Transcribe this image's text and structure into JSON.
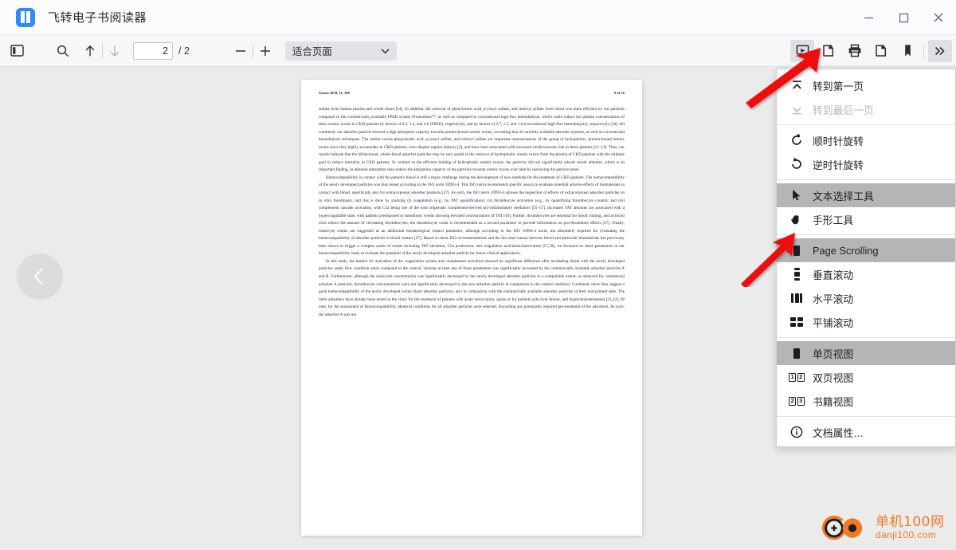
{
  "window": {
    "title": "飞转电子书阅读器",
    "app_icon": "book-icon",
    "minimize_label": "−",
    "maximize_label": "□",
    "close_label": "×"
  },
  "toolbar": {
    "sidebar_toggle": "sidebar-toggle-icon",
    "search": "search-icon",
    "prev_match": "arrow-up-icon",
    "next_match": "arrow-down-icon",
    "page_value": "2",
    "page_total": "/ 2",
    "page_placeholder": "",
    "zoom_out_label": "−",
    "zoom_in_label": "+",
    "zoom_select_value": "适合页面",
    "zoom_chevron": "chevron-down-icon",
    "presentation": "presentation-icon",
    "open_file": "open-file-icon",
    "print": "print-icon",
    "save_file": "save-file-icon",
    "bookmark": "bookmark-icon",
    "more_label": "»"
  },
  "menu": {
    "groups": [
      {
        "items": [
          {
            "label": "转到第一页",
            "icon": "go-first-page-icon",
            "state": "normal"
          },
          {
            "label": "转到最后一页",
            "icon": "go-last-page-icon",
            "state": "disabled"
          }
        ]
      },
      {
        "items": [
          {
            "label": "顺时针旋转",
            "icon": "rotate-clockwise-icon",
            "state": "normal"
          },
          {
            "label": "逆时针旋转",
            "icon": "rotate-counterclockwise-icon",
            "state": "normal"
          }
        ]
      },
      {
        "items": [
          {
            "label": "文本选择工具",
            "icon": "text-select-cursor-icon",
            "state": "selected"
          },
          {
            "label": "手形工具",
            "icon": "hand-tool-icon",
            "state": "normal"
          }
        ]
      },
      {
        "items": [
          {
            "label": "Page Scrolling",
            "icon": "page-scrolling-icon",
            "state": "selected"
          },
          {
            "label": "垂直滚动",
            "icon": "vertical-scrolling-icon",
            "state": "normal"
          },
          {
            "label": "水平滚动",
            "icon": "horizontal-scrolling-icon",
            "state": "normal"
          },
          {
            "label": "平铺滚动",
            "icon": "wrapped-scrolling-icon",
            "state": "normal"
          }
        ]
      },
      {
        "items": [
          {
            "label": "单页视图",
            "icon": "single-page-view-icon",
            "state": "selected"
          },
          {
            "label": "双页视图",
            "icon": "dual-page-view-icon",
            "state": "normal",
            "digits": [
              "1",
              "2"
            ]
          },
          {
            "label": "书籍视图",
            "icon": "book-view-icon",
            "state": "normal",
            "digits": [
              "2",
              "3"
            ]
          }
        ]
      },
      {
        "items": [
          {
            "label": "文档属性…",
            "icon": "info-circle-icon",
            "state": "normal"
          }
        ]
      }
    ]
  },
  "viewer": {
    "prev_page_label": "‹",
    "next_page_label": "›"
  },
  "document": {
    "header_left": "Toxins 2019, 11, 389",
    "header_right": "9 of 16",
    "paragraphs": [
      "sulfate from human plasma and whole blood [54]. In addition, the removal of phenylacetic acid, p-cresyl sulfate, and indoxyl sulfate from blood was more efficient by our particles compared to the commercially available FPAD system Prometheus™, as well as compared to conventional high-flux hemodialysis, which could reduce the plasma concentrations of these uremic toxins in CKD patients by factors of 6.2, 3.4, and 4.6 (FPAD), respectively, and by factors of 2.7, 1.5, and 1.6 (conventional high-flux hemodialysis), respectively [16]. All combined, our adsorber particle showed a high adsorption capacity towards protein-bound uremic toxins, exceeding that of currently available adsorber systems, as well as conventional hemodialysis techniques. The uremic toxins phenylacetic acid, p-cresyl sulfate, and indoxyl sulfate are important representatives of the group of hydrophobic, protein-bound uremic toxins since they highly accumulate in CKD patients, even despite regular dialysis [2], and have been associated with increased cardiovascular risk in these patients [11–13]. Thus, our results indicate that the bifunctional, whole-blood adsorber particles may be very useful in the removal of hydrophobic uremic toxins from the plasma of CKD patients with the ultimate goal to reduce mortality in CKD patients. In contrast to the efficient binding of hydrophobic uremic toxins, the particles did not significantly adsorb serum albumin, which is an important finding, as albumin adsorption may reduce the adsorption capacity of the particles towards uremic toxins over time by narrowing the particle pores.",
      "Hemocompatibility in contact with the patient's blood is still a major challenge during the development of new methods for the treatment of CKD patients. The hemocompatibility of the newly developed particles was thus tested according to the ISO norm 10993-4. This ISO norm recommends specific assays to evaluate potential adverse effects of biomaterials in contact with blood, specifically also for extracorporeal adsorber products [27]. As such, the ISO norm 10993-4 advises the inspection of effects of extracorporeal adsorber particles on in vitro thrombosis, and this is done by studying (i) coagulation (e.g., by TAT quantification); (ii) thrombocyte activation (e.g., by quantifying thrombocyte counts); and (iii) complement cascade activation, with C5a being one of the most important complement-derived pro-inflammatory mediators [55–57]. Increased TAT amounts are associated with a hypercoagulable state, with patients predisposed to thrombotic events showing elevated concentrations of TAT [58]. Further, thrombocytes are essential for blood clotting, and as blood clots reduce the amount of circulating thrombocytes, the thrombocyte count is recommended as a second parameter to provide information on pro-thrombotic effects [27]. Finally, leukocyte counts are suggested as an additional hematological control parameter, although according to the ISO 10993-4 norm, not absolutely required for evaluating the hemocompatibility of adsorber particles in blood contact [27]. Based on these ISO recommendations and the fact that contact between blood and particular biomaterials has previously been shown to trigger a complex series of events including TAT elevation, C5a production, and coagulation activation/inactivation [57,59], we focussed on these parameters in our hemocompatibility study to evaluate the potential of the newly developed adsorber particle for future clinical applications.",
      "In this study, the marker for activation of the coagulation system and complement activation showed no significant difference after incubating blood with the newly developed particles under flow condition when compared to the control, whereas at least one of these parameters was significantly increased by the commercially available adsorber particles A and B. Furthermore, although the leukocyte concentration was significantly decreased by the newly developed adsorber particles to a comparable extent, as observed for commercial adsorber A particles, thrombocyte concentrations were not significantly decreased by the new adsorber particle in comparison to the control condition. Combined, these data suggest a good hemocompatibility of the newly developed whole blood adsorber particles, also in comparison with the commercially available adsorber particles in their non-primed state. The latter adsorbers have already been tested in the clinic for the treatment of patients with acute intoxication, sepsis or for patients with liver failure, and hypercholesterinemia [21,22]. Of note, for the assessment of hemocompatibility, identical conditions for all adsorber particles were selected, discarding any potentially required pre-treatment of the adsorbers. As such, the adsorber A was not"
    ]
  },
  "watermark": {
    "cn_text": "单机100网",
    "en_text": "danji100.com",
    "color": "#f07a22"
  },
  "annotations": {
    "arrow_color": "#ee1111",
    "arrow_top_target": "presentation-icon",
    "arrow_bottom_target": "page-scrolling-menu-item"
  }
}
